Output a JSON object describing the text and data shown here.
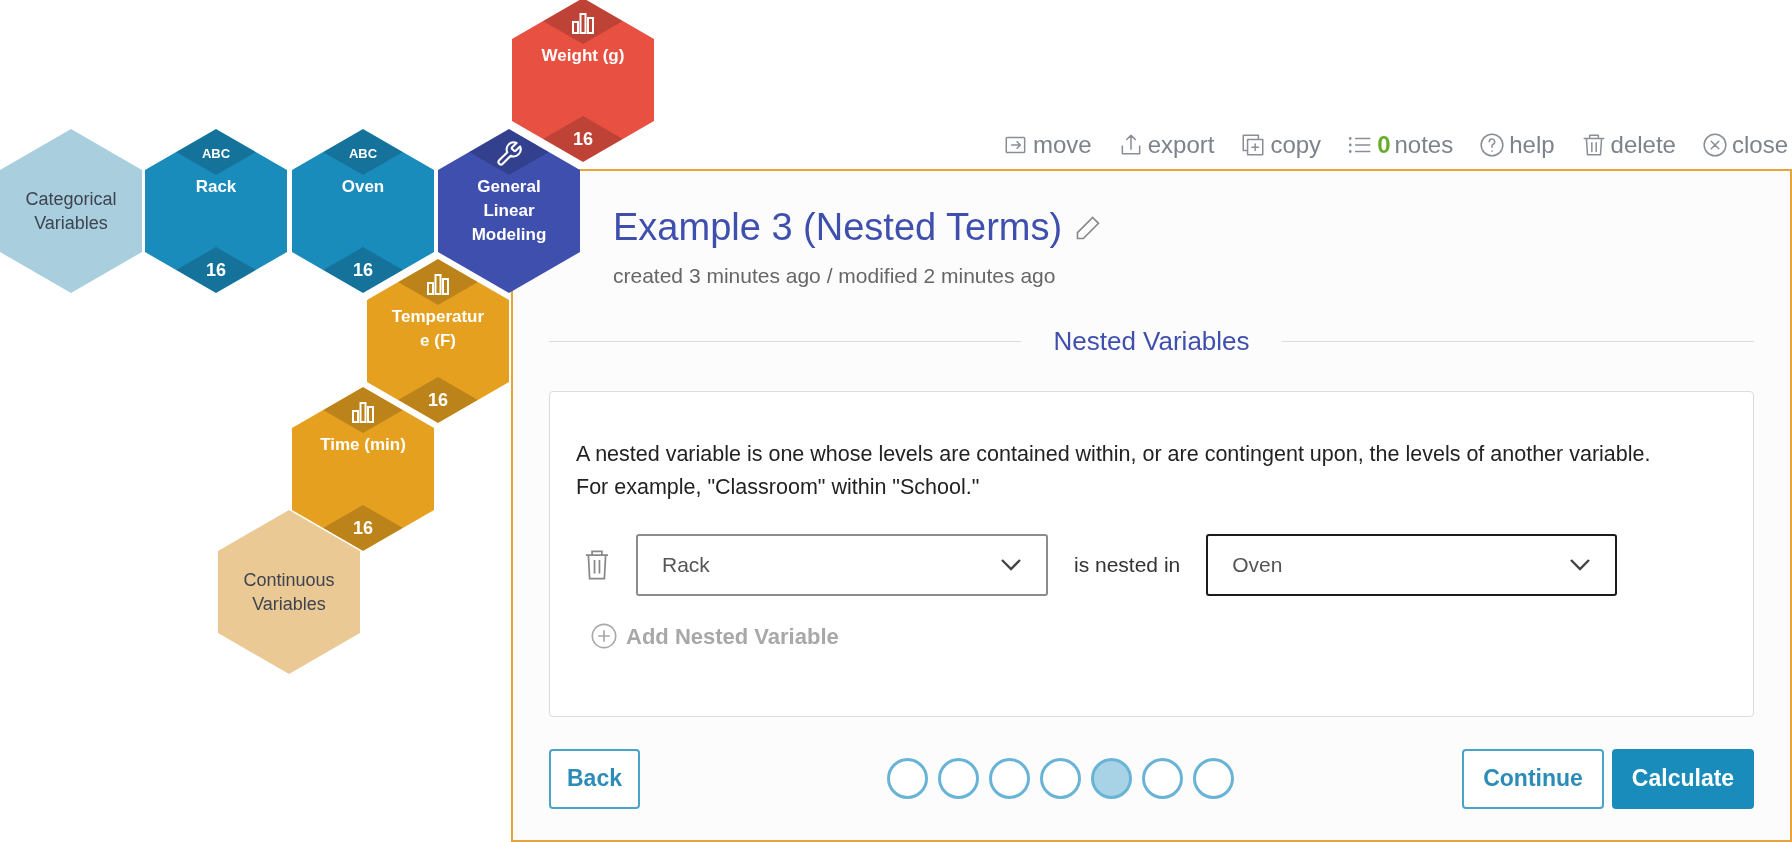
{
  "hexes": [
    {
      "kind": "group",
      "label": "Categorical Variables",
      "color": "#a9cfdf"
    },
    {
      "kind": "categorical",
      "badge": "ABC",
      "label": "Rack",
      "count": "16",
      "color": "#1a8cbc"
    },
    {
      "kind": "categorical",
      "badge": "ABC",
      "label": "Oven",
      "count": "16",
      "color": "#1a8cbc"
    },
    {
      "kind": "tool",
      "label": "General Linear Modeling",
      "color": "#3f4fae"
    },
    {
      "kind": "numeric",
      "label": "Weight (g)",
      "count": "16",
      "color": "#e85142"
    },
    {
      "kind": "numeric",
      "label": "Temperature (F)",
      "count": "16",
      "color": "#e5a020"
    },
    {
      "kind": "numeric",
      "label": "Time (min)",
      "count": "16",
      "color": "#e5a020"
    },
    {
      "kind": "group",
      "label": "Continuous Variables",
      "color": "#ebc994"
    }
  ],
  "toolbar": [
    {
      "kind": "move",
      "label": "move"
    },
    {
      "kind": "export",
      "label": "export"
    },
    {
      "kind": "copy",
      "label": "copy"
    },
    {
      "kind": "notes",
      "count": "0",
      "label": "notes"
    },
    {
      "kind": "help",
      "label": "help"
    },
    {
      "kind": "delete",
      "label": "delete"
    },
    {
      "kind": "close",
      "label": "close"
    }
  ],
  "title": "Example 3 (Nested Terms)",
  "meta": "created 3 minutes ago / modified 2 minutes ago",
  "section": "Nested Variables",
  "description": "A nested variable is one whose levels are contained within, or are contingent upon, the levels of another variable. For example, \"Classroom\" within \"School.\"",
  "nesting": [
    {
      "inner": {
        "value": "Rack",
        "focused": false
      },
      "connector": "is nested in",
      "outer": {
        "value": "Oven",
        "focused": true
      }
    }
  ],
  "add_button": {
    "label": "Add Nested Variable",
    "disabled": true
  },
  "back_button": "Back",
  "steps": [
    {
      "selected": false
    },
    {
      "selected": false
    },
    {
      "selected": false
    },
    {
      "selected": false
    },
    {
      "selected": true
    },
    {
      "selected": false
    },
    {
      "selected": false
    }
  ],
  "continue_button": "Continue",
  "calculate_button": "Calculate"
}
